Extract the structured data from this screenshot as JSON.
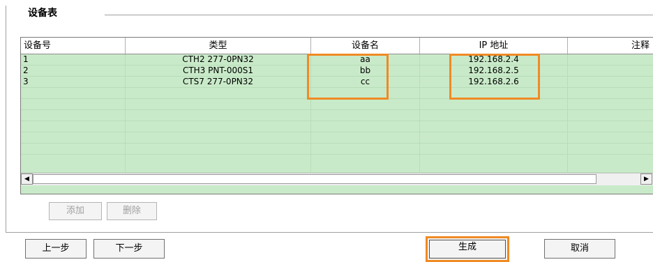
{
  "group": {
    "title": "设备表"
  },
  "table": {
    "headers": [
      "设备号",
      "类型",
      "设备名",
      "IP 地址",
      "注释"
    ],
    "rows": [
      [
        "1",
        "CTH2 277-0PN32",
        "aa",
        "192.168.2.4",
        ""
      ],
      [
        "2",
        "CTH3 PNT-000S1",
        "bb",
        "192.168.2.5",
        ""
      ],
      [
        "3",
        "CTS7 277-0PN32",
        "cc",
        "192.168.2.6",
        ""
      ]
    ],
    "row_background": "#c9eac9",
    "highlight_color": "#f08a24"
  },
  "scrollbar": {
    "left_arrow": "◀",
    "right_arrow": "▶"
  },
  "buttons": {
    "add": "添加",
    "delete": "删除",
    "prev": "上一步",
    "next": "下一步",
    "generate": "生成",
    "cancel": "取消"
  }
}
